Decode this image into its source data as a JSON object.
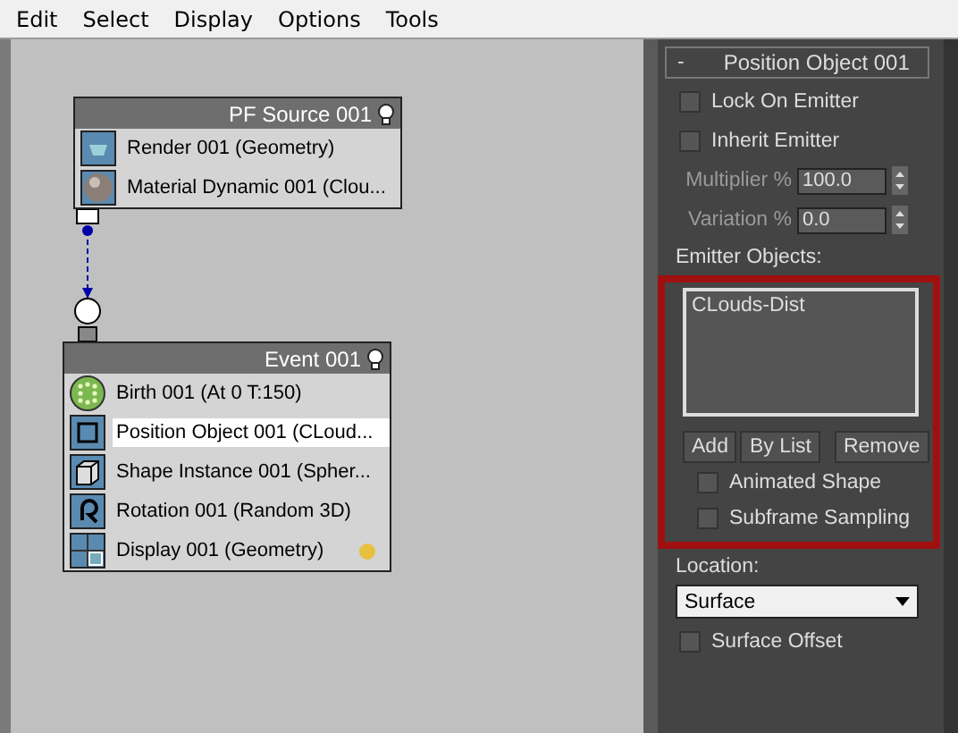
{
  "menu": [
    {
      "label": "Edit"
    },
    {
      "label": "Select"
    },
    {
      "label": "Display"
    },
    {
      "label": "Options"
    },
    {
      "label": "Tools"
    }
  ],
  "graph": {
    "nodes": [
      {
        "title": "PF Source 001",
        "rows": [
          {
            "kind": "render",
            "label": "Render 001 (Geometry)",
            "selected": false
          },
          {
            "kind": "material",
            "label": "Material Dynamic 001 (Clou...",
            "selected": false
          }
        ]
      },
      {
        "title": "Event 001",
        "rows": [
          {
            "kind": "birth",
            "label": "Birth 001 (At 0 T:150)",
            "selected": false
          },
          {
            "kind": "position",
            "label": "Position Object 001 (CLoud...",
            "selected": true
          },
          {
            "kind": "shape",
            "label": "Shape Instance 001 (Spher...",
            "selected": false
          },
          {
            "kind": "rotation",
            "label": "Rotation 001 (Random 3D)",
            "selected": false
          },
          {
            "kind": "display",
            "label": "Display 001 (Geometry)",
            "selected": false,
            "color": "#e8c040"
          }
        ]
      }
    ]
  },
  "panel": {
    "rollout": {
      "toggle": "-",
      "title": "Position Object 001"
    },
    "options": [
      {
        "label": "Lock On Emitter",
        "checked": false
      },
      {
        "label": "Inherit Emitter",
        "checked": false
      }
    ],
    "spinners": [
      {
        "label": "Multiplier %",
        "value": "100.0",
        "disabled": true
      },
      {
        "label": "Variation %",
        "value": "0.0",
        "disabled": true
      }
    ],
    "emitter_objects": {
      "title": "Emitter Objects:",
      "items": [
        "CLouds-Dist"
      ],
      "buttons": [
        "Add",
        "By List",
        "Remove"
      ],
      "options": [
        {
          "label": "Animated Shape",
          "checked": false
        },
        {
          "label": "Subframe Sampling",
          "checked": false
        }
      ]
    },
    "location": {
      "title": "Location:",
      "value": "Surface",
      "options": [
        {
          "label": "Surface Offset",
          "checked": false
        }
      ]
    }
  }
}
